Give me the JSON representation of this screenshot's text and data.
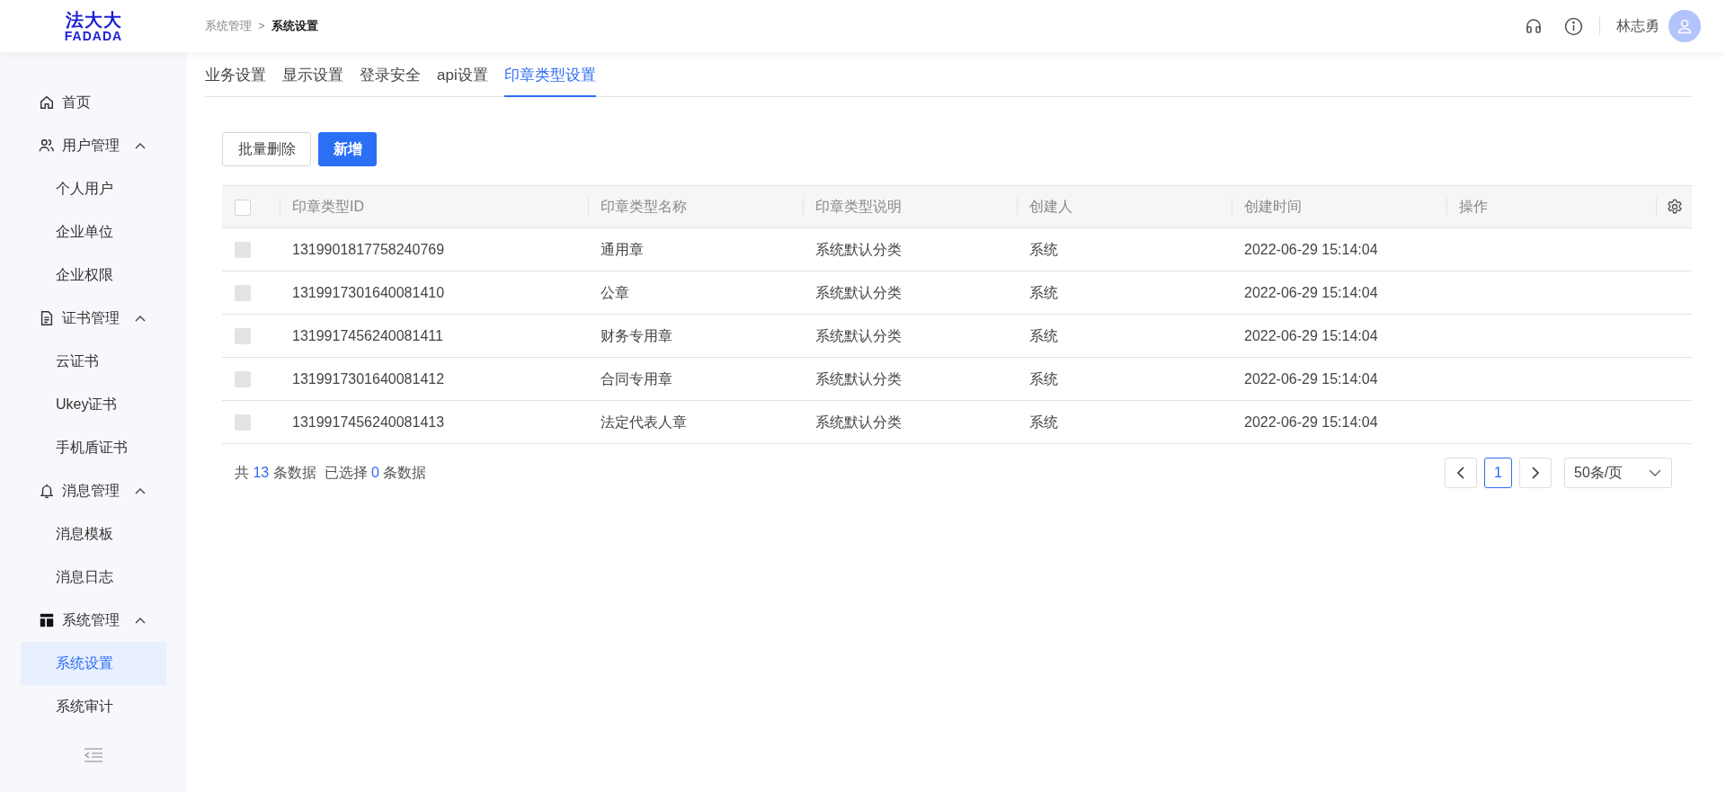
{
  "header": {
    "logo": {
      "name": "法大大",
      "wordmark": "FADADA"
    },
    "breadcrumb": [
      "系统管理",
      "系统设置"
    ],
    "breadcrumb_separator": ">",
    "user_name": "林志勇"
  },
  "sidebar": {
    "items": [
      {
        "label": "首页",
        "selected": false
      },
      {
        "label": "用户管理",
        "expanded": true,
        "children": [
          {
            "label": "个人用户",
            "selected": false
          },
          {
            "label": "企业单位",
            "selected": false
          },
          {
            "label": "企业权限",
            "selected": false
          }
        ]
      },
      {
        "label": "证书管理",
        "expanded": true,
        "children": [
          {
            "label": "云证书",
            "selected": false
          },
          {
            "label": "Ukey证书",
            "selected": false
          },
          {
            "label": "手机盾证书",
            "selected": false
          }
        ]
      },
      {
        "label": "消息管理",
        "expanded": true,
        "children": [
          {
            "label": "消息模板",
            "selected": false
          },
          {
            "label": "消息日志",
            "selected": false
          }
        ]
      },
      {
        "label": "系统管理",
        "expanded": true,
        "children": [
          {
            "label": "系统设置",
            "selected": true
          },
          {
            "label": "系统审计",
            "selected": false
          }
        ]
      }
    ]
  },
  "tabs": [
    {
      "label": "业务设置",
      "selected": false
    },
    {
      "label": "显示设置",
      "selected": false
    },
    {
      "label": "登录安全",
      "selected": false
    },
    {
      "label": "api设置",
      "selected": false
    },
    {
      "label": "印章类型设置",
      "selected": true
    }
  ],
  "toolbar": {
    "buttons": [
      {
        "label": "批量删除",
        "kind": "default"
      },
      {
        "label": "新增",
        "kind": "primary"
      }
    ]
  },
  "table": {
    "header_checked": false,
    "columns": [
      "印章类型ID",
      "印章类型名称",
      "印章类型说明",
      "创建人",
      "创建时间",
      "操作"
    ],
    "rows": [
      {
        "checked": false,
        "disabled": true,
        "cells": [
          "1319901817758240769",
          "通用章",
          "系统默认分类",
          "系统",
          "2022-06-29 15:14:04"
        ]
      },
      {
        "checked": false,
        "disabled": true,
        "cells": [
          "1319917301640081410",
          "公章",
          "系统默认分类",
          "系统",
          "2022-06-29 15:14:04"
        ]
      },
      {
        "checked": false,
        "disabled": true,
        "cells": [
          "1319917456240081411",
          "财务专用章",
          "系统默认分类",
          "系统",
          "2022-06-29 15:14:04"
        ]
      },
      {
        "checked": false,
        "disabled": true,
        "cells": [
          "1319917301640081412",
          "合同专用章",
          "系统默认分类",
          "系统",
          "2022-06-29 15:14:04"
        ]
      },
      {
        "checked": false,
        "disabled": true,
        "cells": [
          "1319917456240081413",
          "法定代表人章",
          "系统默认分类",
          "系统",
          "2022-06-29 15:14:04"
        ]
      }
    ]
  },
  "footer": {
    "summary": [
      {
        "text": "共 ",
        "kind": "plain"
      },
      {
        "text": "13",
        "kind": "count"
      },
      {
        "text": " 条数据  已选择 ",
        "kind": "plain"
      },
      {
        "text": "0",
        "kind": "count"
      },
      {
        "text": " 条数据",
        "kind": "plain"
      }
    ],
    "pages": [
      {
        "label": "1",
        "selected": true
      }
    ],
    "page_size": "50条/页"
  }
}
